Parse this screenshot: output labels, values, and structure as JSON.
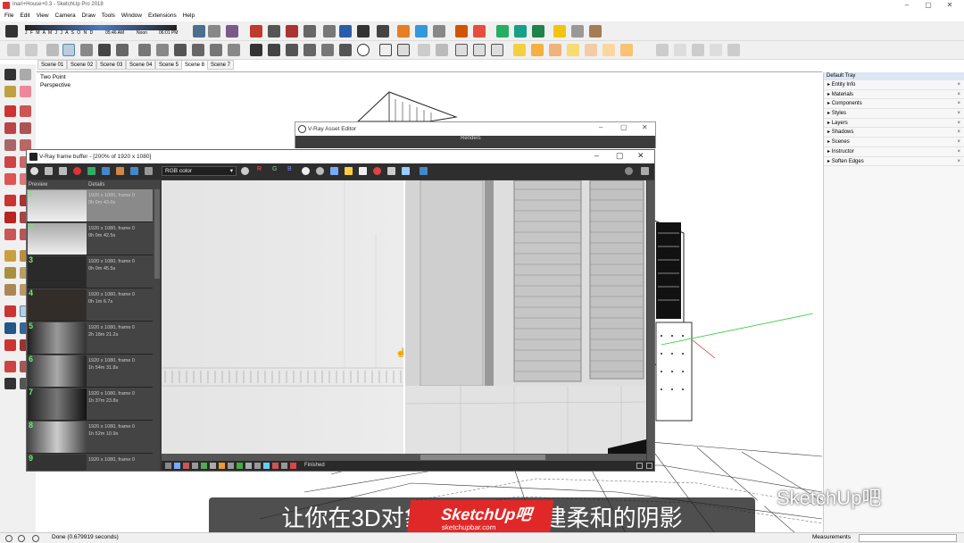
{
  "window": {
    "title": "Inari+House+0.3 - SketchUp Pro 2018",
    "min": "–",
    "max": "▢",
    "close": "✕"
  },
  "menu": [
    "File",
    "Edit",
    "View",
    "Camera",
    "Draw",
    "Tools",
    "Window",
    "Extensions",
    "Help"
  ],
  "shadow_bar": {
    "months": "J F M A M J J A S O N D",
    "time_start": "05:46 AM",
    "time_mid": "Noon",
    "time_end": "06:01 PM"
  },
  "scenes": [
    "Scene 01",
    "Scene 02",
    "Scene 03",
    "Scene 04",
    "Scene 5",
    "Scene 8",
    "Scene 7"
  ],
  "viewport": {
    "camera_line1": "Two Point",
    "camera_line2": "Perspective"
  },
  "tray": {
    "title": "Default Tray",
    "items": [
      "Entity Info",
      "Materials",
      "Components",
      "Styles",
      "Layers",
      "Shadows",
      "Scenes",
      "Instructor",
      "Soften Edges"
    ]
  },
  "asset_editor": {
    "title": "V-Ray Asset Editor",
    "section": "Renders"
  },
  "frame_buffer": {
    "title": "V-Ray frame buffer - [200% of 1920 x 1080]",
    "channel": "RGB color",
    "channel_buttons": [
      "R",
      "G",
      "B"
    ],
    "history_headers": [
      "Preview",
      "Details"
    ],
    "history": [
      {
        "num": "1",
        "line1": "1920 x 1080, frame 0",
        "line2": "0h 0m 43.6s"
      },
      {
        "num": "2",
        "line1": "1920 x 1080, frame 0",
        "line2": "0h 0m 42.5s"
      },
      {
        "num": "3",
        "line1": "1920 x 1080, frame 0",
        "line2": "0h 0m 45.5s"
      },
      {
        "num": "4",
        "line1": "1920 x 1080, frame 0",
        "line2": "0h 1m 6.7s"
      },
      {
        "num": "5",
        "line1": "1920 x 1080, frame 0",
        "line2": "2h 18m 21.2s"
      },
      {
        "num": "6",
        "line1": "1920 x 1080, frame 0",
        "line2": "1h 54m 31.8s"
      },
      {
        "num": "7",
        "line1": "1920 x 1080, frame 0",
        "line2": "1h 37m 23.8s"
      },
      {
        "num": "8",
        "line1": "1920 x 1080, frame 0",
        "line2": "1h 52m 10.9s"
      },
      {
        "num": "9",
        "line1": "1920 x 1080, frame 0",
        "line2": ""
      }
    ],
    "status": "Finished"
  },
  "statusbar": {
    "message": "Done (0.679919 seconds)",
    "measurements_label": "Measurements"
  },
  "subtitle": "让你在3D对象的表面上创建柔和的阴影",
  "watermark": {
    "text": "SketchUp吧",
    "logo_text": "SketchUp吧",
    "logo_sub": "sketchupbar.com"
  },
  "colors": {
    "accent_red": "#d32f2f",
    "vfb_dark": "#3a3a3a",
    "tray_header": "#dde7f3"
  }
}
